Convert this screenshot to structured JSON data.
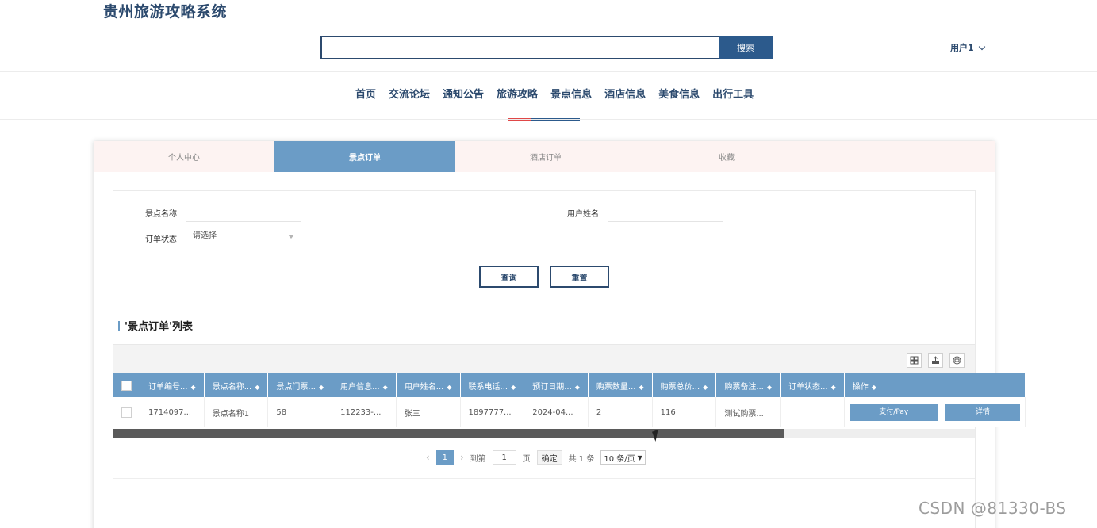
{
  "site": {
    "title": "贵州旅游攻略系统"
  },
  "search": {
    "placeholder": "",
    "button": "搜索"
  },
  "user": {
    "name": "用户1"
  },
  "nav": {
    "items": [
      "首页",
      "交流论坛",
      "通知公告",
      "旅游攻略",
      "景点信息",
      "酒店信息",
      "美食信息",
      "出行工具"
    ],
    "active": "景点信息"
  },
  "tabs": {
    "items": [
      "个人中心",
      "景点订单",
      "酒店订单",
      "收藏"
    ],
    "active": "景点订单"
  },
  "filter": {
    "scenic_name_label": "景点名称",
    "user_name_label": "用户姓名",
    "status_label": "订单状态",
    "status_placeholder": "请选择",
    "query_button": "查询",
    "reset_button": "重置"
  },
  "list": {
    "title": "'景点订单'列表",
    "columns": [
      "订单编号...",
      "景点名称...",
      "景点门票...",
      "用户信息...",
      "用户姓名...",
      "联系电话...",
      "预订日期...",
      "购票数量...",
      "购票总价...",
      "购票备注...",
      "订单状态...",
      "操作"
    ],
    "rows": [
      {
        "order_no": "1714097...",
        "scenic_name": "景点名称1",
        "ticket": "58",
        "user_info": "112233-...",
        "user_name": "张三",
        "phone": "1897777...",
        "date": "2024-04...",
        "quantity": "2",
        "total": "116",
        "remark": "测试购票...",
        "status": "",
        "pay_button": "支付/Pay",
        "detail_button": "详情"
      }
    ]
  },
  "pager": {
    "current_page": "1",
    "goto_label": "到第",
    "goto_value": "1",
    "page_unit": "页",
    "confirm": "确定",
    "total": "共 1 条",
    "page_size": "10 条/页"
  },
  "watermark": "CSDN @81330-BS",
  "colors": {
    "primary": "#2c4a6e",
    "accent": "#6b9cc6",
    "tab_bg": "#fdf3f2",
    "nav_red": "#e04848"
  },
  "icons": {
    "toolbar": [
      "columns-icon",
      "export-icon",
      "print-icon"
    ]
  }
}
